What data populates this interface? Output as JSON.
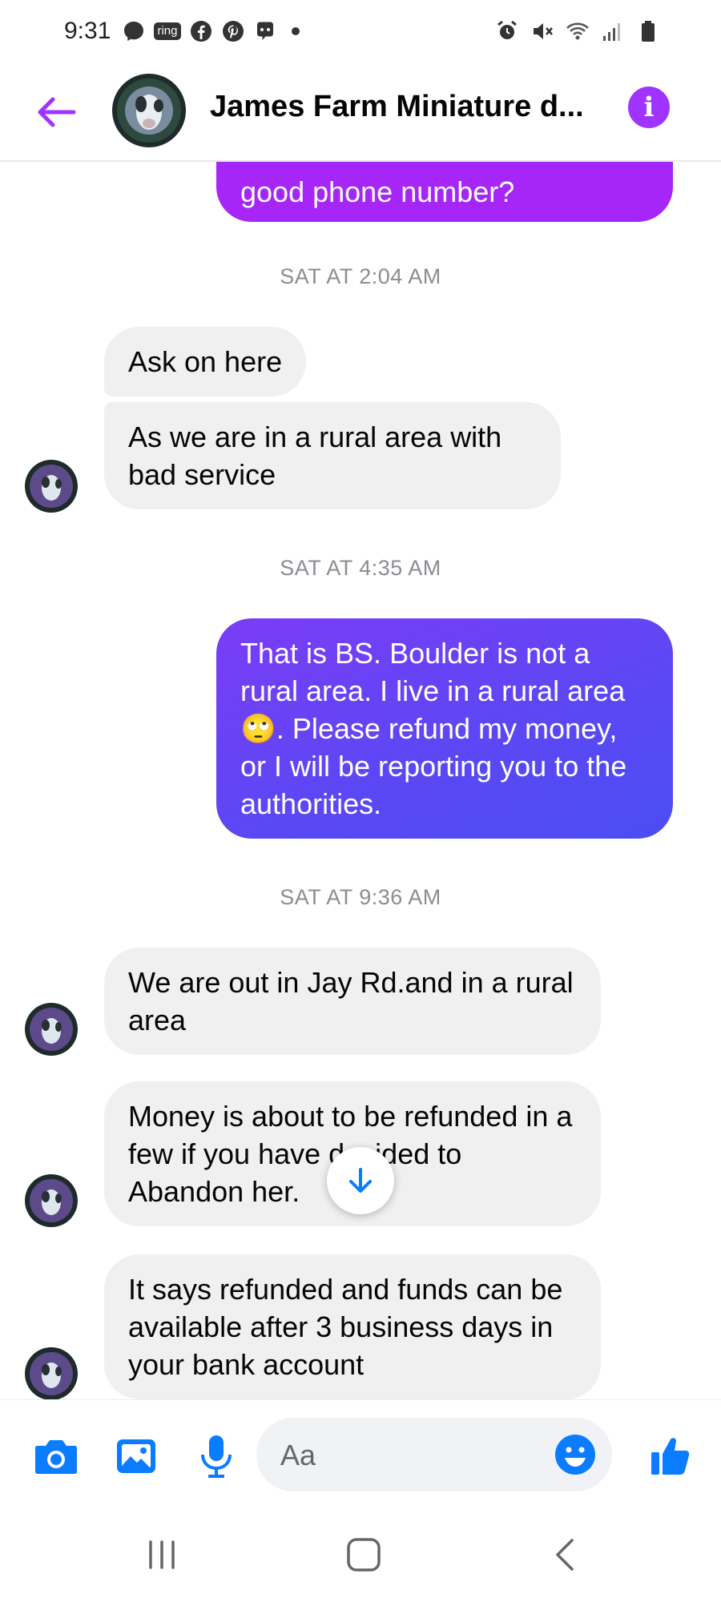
{
  "status_bar": {
    "time": "9:31",
    "left_icons": [
      "messenger-icon",
      "ring-icon",
      "facebook-icon",
      "pinterest-icon",
      "mastodon-icon"
    ],
    "ring_label": "ring",
    "right_icons": [
      "alarm-icon",
      "mute-icon",
      "wifi-icon",
      "signal-icon",
      "battery-icon"
    ]
  },
  "header": {
    "title": "James Farm Miniature d...",
    "info_label": "i"
  },
  "messages": {
    "m0": "good phone number?",
    "ts1": "SAT AT 2:04 AM",
    "m1": "Ask on here",
    "m2": "As we are in a rural area with bad service",
    "ts2": "SAT AT 4:35 AM",
    "m3a": "That is BS. Boulder is not a rural area. I live in a rural area ",
    "m3_emoji": "🙄",
    "m3b": ". Please refund my money, or I will be reporting you to the authorities.",
    "ts3": "SAT AT 9:36 AM",
    "m4": "We are out in Jay Rd.and in a rural area",
    "m5": "Money is about to be refunded in a few if you have decided to Abandon her.",
    "m6": "It says refunded and funds can be available after 3 business days in your bank account"
  },
  "composer": {
    "placeholder": "Aa"
  },
  "colors": {
    "accent": "#a033ff",
    "outgoing_purple": "#a526f6",
    "outgoing_blue": "#5a48f4",
    "incoming_bg": "#f0f0f0",
    "icon_blue": "#0a7cff"
  }
}
